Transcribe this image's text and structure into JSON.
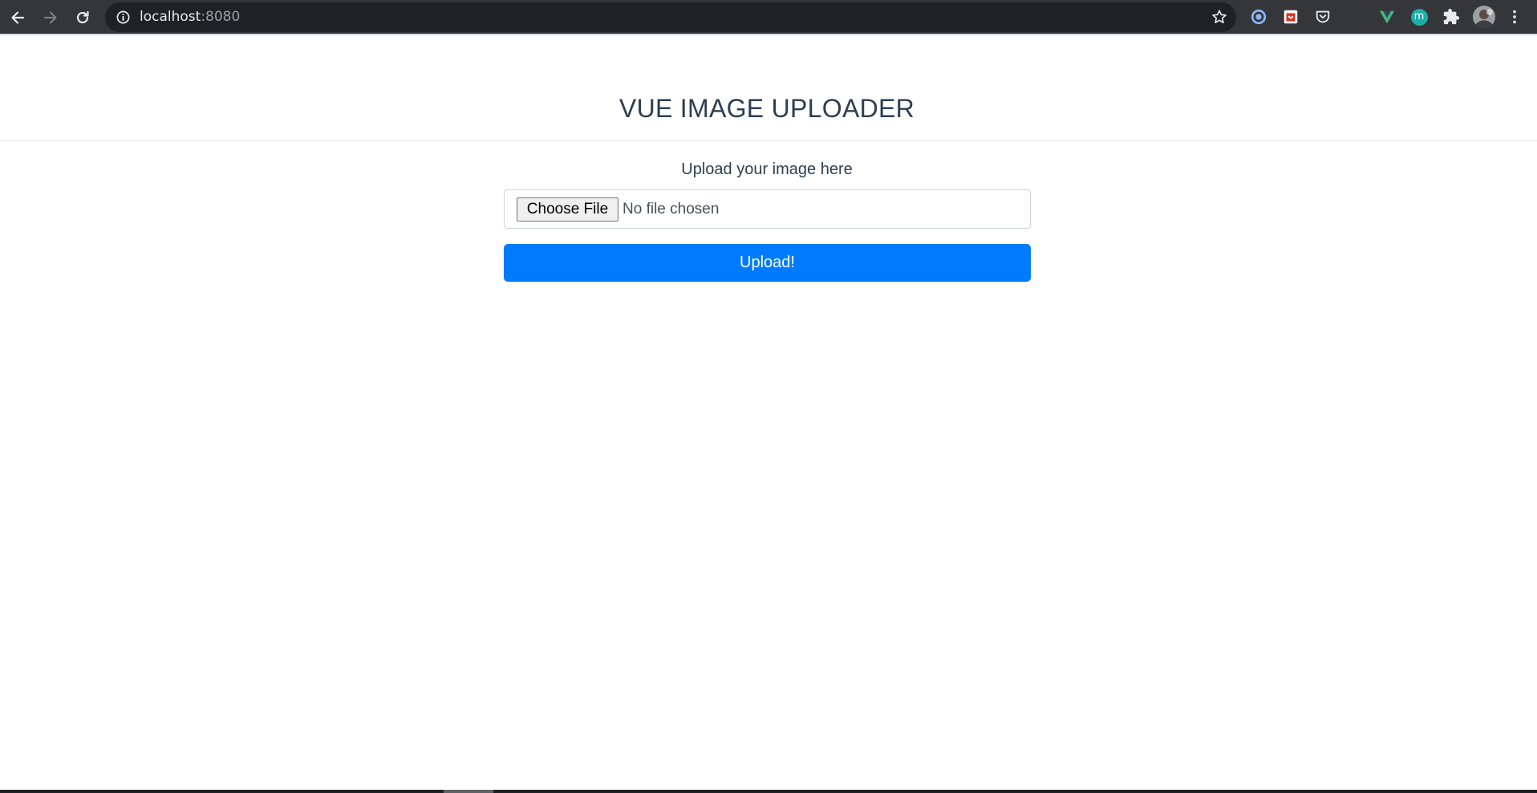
{
  "browser": {
    "url_host": "localhost",
    "url_port": ":8080",
    "icons": {
      "back": "back-arrow-icon",
      "forward": "forward-arrow-icon",
      "reload": "reload-icon",
      "site_info": "info-icon",
      "bookmark": "star-icon",
      "extensions": [
        "extension-blue-circle-icon",
        "extension-red-calendar-icon",
        "pocket-icon",
        "vue-devtools-icon",
        "extension-teal-m-icon",
        "puzzle-icon"
      ],
      "profile": "avatar",
      "menu": "kebab-menu-icon"
    },
    "teal_badge_letter": "m",
    "colors": {
      "toolbar": "#35363a",
      "omnibox": "#202124",
      "vue_green": "#41b883",
      "teal": "#1ab0a8"
    }
  },
  "page": {
    "title": "VUE IMAGE UPLOADER",
    "upload_label": "Upload your image here",
    "file_input": {
      "button_label": "Choose File",
      "status_text": "No file chosen"
    },
    "upload_button_label": "Upload!",
    "colors": {
      "text": "#2c3e50",
      "primary": "#007bff"
    }
  }
}
